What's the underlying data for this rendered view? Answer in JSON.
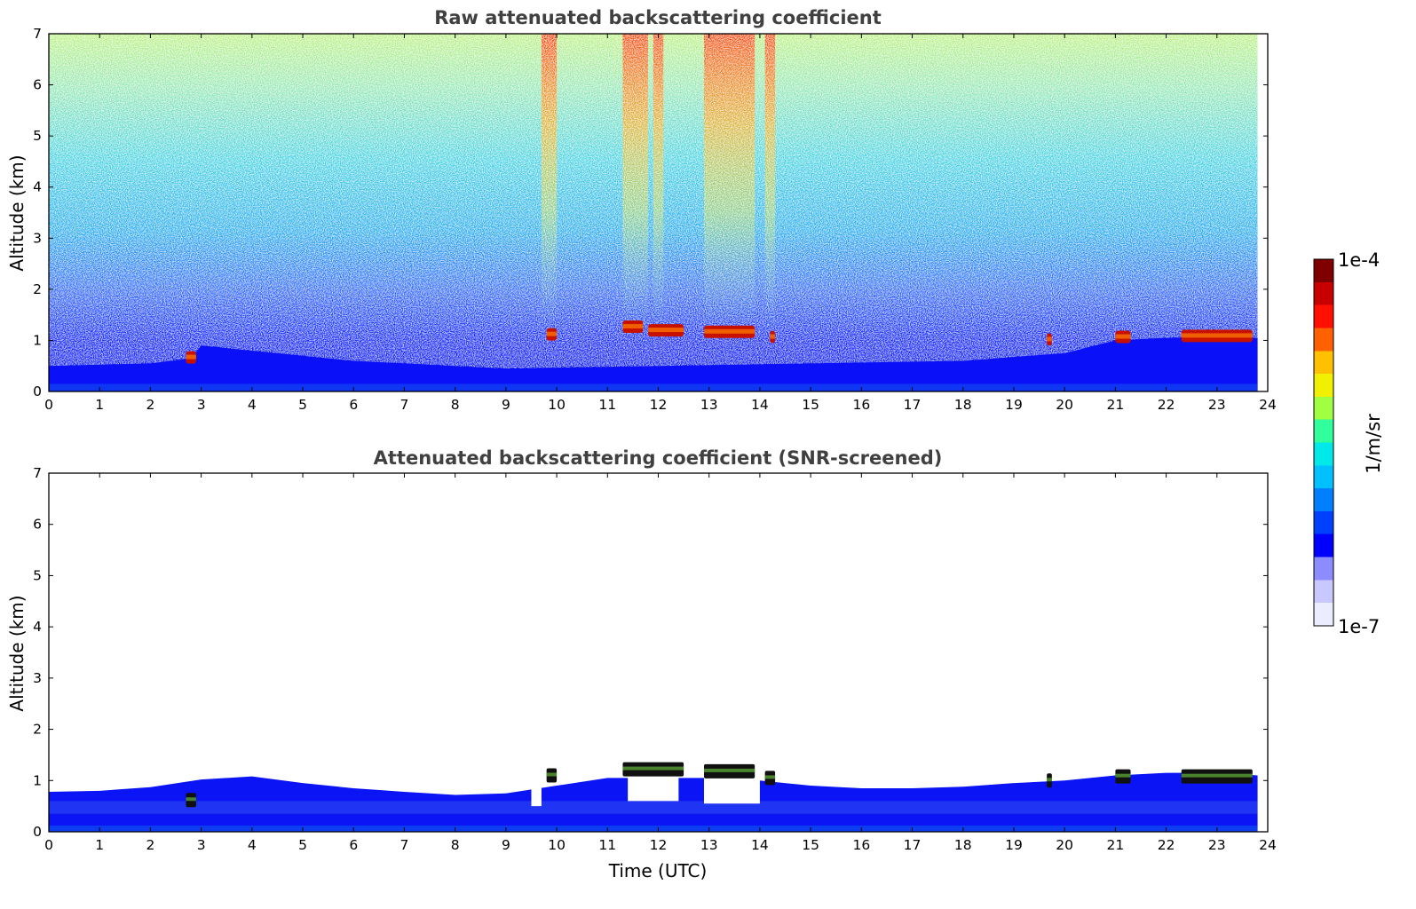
{
  "chart_data": [
    {
      "type": "heatmap",
      "title": "Raw attenuated backscattering coefficient",
      "xlabel": "",
      "ylabel": "Altitude (km)",
      "xlim": [
        0,
        24
      ],
      "ylim": [
        0,
        7
      ],
      "xticks": [
        0,
        1,
        2,
        3,
        4,
        5,
        6,
        7,
        8,
        9,
        10,
        11,
        12,
        13,
        14,
        15,
        16,
        17,
        18,
        19,
        20,
        21,
        22,
        23,
        24
      ],
      "yticks": [
        0,
        1,
        2,
        3,
        4,
        5,
        6,
        7
      ],
      "data_end_hour": 23.8,
      "boundary_layer_top_km": [
        [
          0,
          0.5
        ],
        [
          2,
          0.55
        ],
        [
          2.8,
          0.65
        ],
        [
          3,
          0.9
        ],
        [
          4,
          0.8
        ],
        [
          6,
          0.6
        ],
        [
          9,
          0.45
        ],
        [
          12,
          0.5
        ],
        [
          15,
          0.55
        ],
        [
          18,
          0.6
        ],
        [
          20,
          0.75
        ],
        [
          21,
          1.0
        ],
        [
          22,
          1.05
        ],
        [
          23.8,
          1.05
        ]
      ],
      "cloud_layers": [
        {
          "x": [
            2.7,
            2.9
          ],
          "altitude_km": 0.65
        },
        {
          "x": [
            9.8,
            10.0
          ],
          "altitude_km": 1.1
        },
        {
          "x": [
            11.3,
            11.7
          ],
          "altitude_km": 1.25
        },
        {
          "x": [
            11.8,
            12.5
          ],
          "altitude_km": 1.18
        },
        {
          "x": [
            12.9,
            13.9
          ],
          "altitude_km": 1.15
        },
        {
          "x": [
            14.2,
            14.3
          ],
          "altitude_km": 1.05
        },
        {
          "x": [
            19.65,
            19.75
          ],
          "altitude_km": 1.0
        },
        {
          "x": [
            21.0,
            21.3
          ],
          "altitude_km": 1.05
        },
        {
          "x": [
            22.3,
            23.7
          ],
          "altitude_km": 1.07
        }
      ],
      "high_signal_streaks_hours": [
        [
          9.7,
          10.0
        ],
        [
          11.3,
          11.8
        ],
        [
          11.9,
          12.1
        ],
        [
          12.9,
          13.9
        ],
        [
          14.1,
          14.3
        ]
      ]
    },
    {
      "type": "heatmap",
      "title": "Attenuated backscattering coefficient (SNR-screened)",
      "xlabel": "Time (UTC)",
      "ylabel": "Altitude (km)",
      "xlim": [
        0,
        24
      ],
      "ylim": [
        0,
        7
      ],
      "xticks": [
        0,
        1,
        2,
        3,
        4,
        5,
        6,
        7,
        8,
        9,
        10,
        11,
        12,
        13,
        14,
        15,
        16,
        17,
        18,
        19,
        20,
        21,
        22,
        23,
        24
      ],
      "yticks": [
        0,
        1,
        2,
        3,
        4,
        5,
        6,
        7
      ],
      "data_end_hour": 23.8,
      "screened_top_km": [
        [
          0,
          0.78
        ],
        [
          1,
          0.8
        ],
        [
          2,
          0.87
        ],
        [
          3,
          1.02
        ],
        [
          4,
          1.08
        ],
        [
          5,
          0.95
        ],
        [
          6,
          0.85
        ],
        [
          7,
          0.78
        ],
        [
          8,
          0.72
        ],
        [
          9,
          0.75
        ],
        [
          10,
          0.9
        ],
        [
          11,
          1.05
        ],
        [
          12,
          1.05
        ],
        [
          13,
          1.05
        ],
        [
          14,
          1.0
        ],
        [
          15,
          0.9
        ],
        [
          16,
          0.85
        ],
        [
          17,
          0.85
        ],
        [
          18,
          0.88
        ],
        [
          19,
          0.95
        ],
        [
          20,
          1.0
        ],
        [
          21,
          1.1
        ],
        [
          22,
          1.15
        ],
        [
          23,
          1.15
        ],
        [
          23.8,
          1.1
        ]
      ],
      "cloud_layers": [
        {
          "x": [
            2.7,
            2.9
          ],
          "altitude_km": 0.62
        },
        {
          "x": [
            9.8,
            10.0
          ],
          "altitude_km": 1.1
        },
        {
          "x": [
            11.3,
            12.5
          ],
          "altitude_km": 1.22
        },
        {
          "x": [
            12.9,
            13.9
          ],
          "altitude_km": 1.18
        },
        {
          "x": [
            14.1,
            14.3
          ],
          "altitude_km": 1.05
        },
        {
          "x": [
            19.65,
            19.75
          ],
          "altitude_km": 1.0
        },
        {
          "x": [
            21.0,
            21.3
          ],
          "altitude_km": 1.08
        },
        {
          "x": [
            22.3,
            23.7
          ],
          "altitude_km": 1.08
        }
      ],
      "gaps": [
        {
          "x": [
            9.5,
            9.7
          ],
          "top_km": 0.5
        },
        {
          "x": [
            11.4,
            12.4
          ],
          "top_km": 0.6
        },
        {
          "x": [
            12.9,
            14.0
          ],
          "top_km": 0.55
        }
      ]
    }
  ],
  "colorbar": {
    "label": "1/m/sr",
    "max_label": "1e-4",
    "min_label": "1e-7",
    "colormap": [
      "#ececff",
      "#c8c8ff",
      "#8c8cff",
      "#0000ff",
      "#0040ff",
      "#0080ff",
      "#00c0ff",
      "#00e8e8",
      "#30ff9c",
      "#a0ff40",
      "#f0f000",
      "#ffc000",
      "#ff6000",
      "#ff1000",
      "#c80000",
      "#800000"
    ]
  }
}
